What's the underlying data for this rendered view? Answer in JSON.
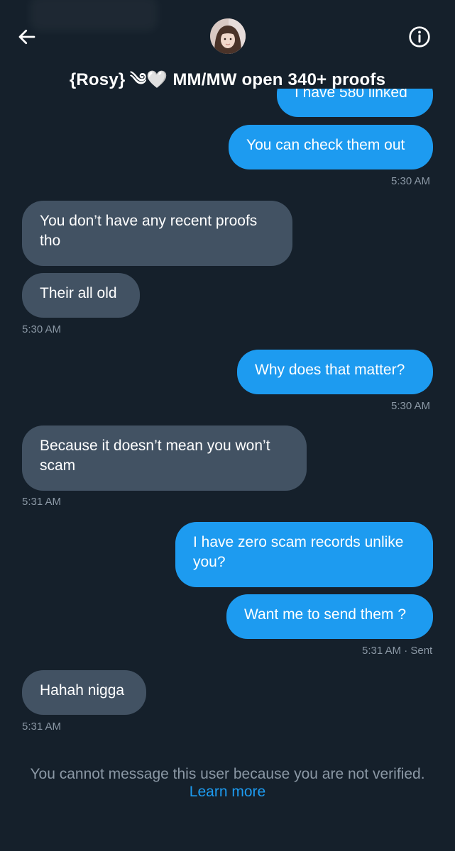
{
  "header": {
    "title": "{Rosy} ༄🤍 MM/MW open 340+ proofs",
    "back_icon": "arrow-left-icon",
    "info_icon": "info-circle-icon"
  },
  "messages": [
    {
      "text": "I have 580 linked",
      "side": "sent"
    },
    {
      "text": "You can check them out",
      "side": "sent",
      "time": "5:30 AM"
    },
    {
      "text": "You don’t have any recent proofs tho",
      "side": "received"
    },
    {
      "text": "Their all old",
      "side": "received",
      "time": "5:30 AM"
    },
    {
      "text": "Why does that matter?",
      "side": "sent",
      "time": "5:30 AM"
    },
    {
      "text": "Because it doesn’t mean you won’t scam",
      "side": "received",
      "time": "5:31 AM"
    },
    {
      "text": "I have zero scam records unlike you?",
      "side": "sent"
    },
    {
      "text": "Want me to send them ?",
      "side": "sent",
      "time": "5:31 AM · Sent"
    },
    {
      "text": "Hahah nigga",
      "side": "received",
      "time": "5:31 AM"
    }
  ],
  "footer": {
    "notice": "You cannot message this user because you are not verified.",
    "link": "Learn more"
  },
  "colors": {
    "background": "#15202b",
    "sent_bubble": "#1d9bf0",
    "received_bubble": "#425263",
    "muted_text": "#8b98a5",
    "link": "#1d9bf0"
  }
}
